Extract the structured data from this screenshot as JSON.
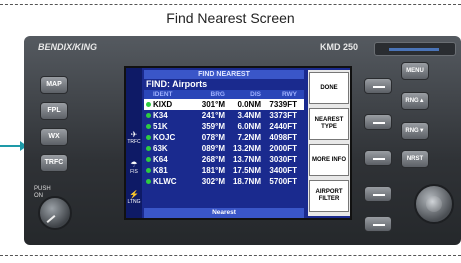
{
  "caption": "Find Nearest Screen",
  "device": {
    "brand": "BENDIX/KING",
    "model": "KMD 250"
  },
  "left_buttons": [
    "MAP",
    "FPL",
    "WX",
    "TRFC"
  ],
  "knob_label": "PUSH ON",
  "sidebar": [
    {
      "icon": "traffic-icon",
      "label": "TRFC",
      "glyph": "✈"
    },
    {
      "icon": "fis-icon",
      "label": "FIS",
      "glyph": "☂"
    },
    {
      "icon": "lightning-icon",
      "label": "LTNG",
      "glyph": "⚡"
    }
  ],
  "panel": {
    "title": "FIND NEAREST",
    "find_label": "FIND:",
    "find_value": "Airports",
    "columns": [
      "IDENT",
      "BRG",
      "DIS",
      "RWY"
    ],
    "rows": [
      {
        "ident": "KIXD",
        "brg": "301°M",
        "dis": "0.0NM",
        "rwy": "7339FT",
        "selected": true
      },
      {
        "ident": "K34",
        "brg": "241°M",
        "dis": "3.4NM",
        "rwy": "3373FT",
        "selected": false
      },
      {
        "ident": "51K",
        "brg": "359°M",
        "dis": "6.0NM",
        "rwy": "2440FT",
        "selected": false
      },
      {
        "ident": "KOJC",
        "brg": "078°M",
        "dis": "7.2NM",
        "rwy": "4098FT",
        "selected": false
      },
      {
        "ident": "63K",
        "brg": "089°M",
        "dis": "13.2NM",
        "rwy": "2000FT",
        "selected": false
      },
      {
        "ident": "K64",
        "brg": "268°M",
        "dis": "13.7NM",
        "rwy": "3030FT",
        "selected": false
      },
      {
        "ident": "K81",
        "brg": "181°M",
        "dis": "17.5NM",
        "rwy": "3400FT",
        "selected": false
      },
      {
        "ident": "KLWC",
        "brg": "302°M",
        "dis": "18.7NM",
        "rwy": "5700FT",
        "selected": false
      }
    ],
    "footer": "Nearest"
  },
  "softkeys": [
    "DONE",
    "NEAREST TYPE",
    "MORE INFO",
    "AIRPORT FILTER"
  ],
  "right_buttons": [
    "MENU",
    "RNG▲",
    "RNG▼",
    "NRST"
  ],
  "colors": {
    "screen_bg": "#1a2a8e",
    "header_bar": "#3a56c8",
    "airport_dot": "#2ecc40",
    "arrow": "#1e9aa8"
  }
}
